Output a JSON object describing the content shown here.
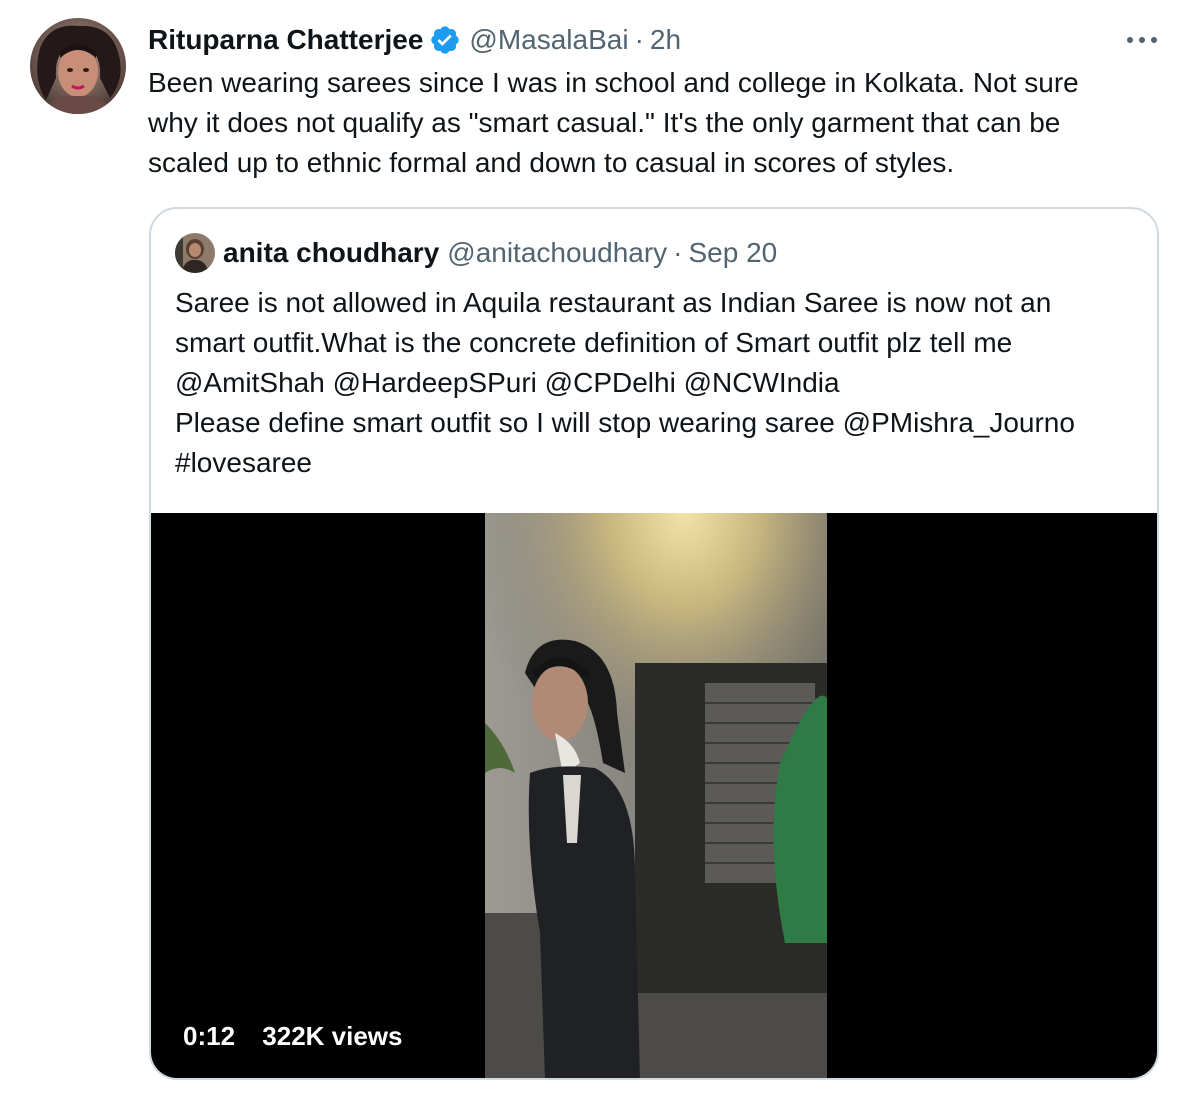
{
  "tweet": {
    "author_name": "Rituparna Chatterjee",
    "verified_icon": "verified-badge-icon",
    "handle": "@MasalaBai",
    "separator": "·",
    "time": "2h",
    "text": "Been wearing sarees since I was in school and college in Kolkata. Not sure\nwhy it does not qualify as \"smart casual.\" It's the only garment that can be\nscaled up to ethnic formal and down to casual in scores of styles.",
    "more_icon": "more-options-icon"
  },
  "quoted_tweet": {
    "author_name": "anita choudhary",
    "handle": "@anitachoudhary",
    "separator": "·",
    "time": "Sep 20",
    "text": "Saree is not allowed in Aquila restaurant as Indian Saree is now not an\nsmart outfit.What is the concrete definition of Smart outfit plz tell me\n@AmitShah @HardeepSPuri @CPDelhi @NCWIndia\nPlease define smart outfit so I will stop wearing saree @PMishra_Journo\n#lovesaree",
    "video": {
      "duration": "0:12",
      "views": "322K views"
    }
  },
  "colors": {
    "text_primary": "#0f1419",
    "text_secondary": "#536471",
    "verified_blue": "#1d9bf0",
    "card_border": "#cfd9de",
    "video_background": "#000000"
  }
}
